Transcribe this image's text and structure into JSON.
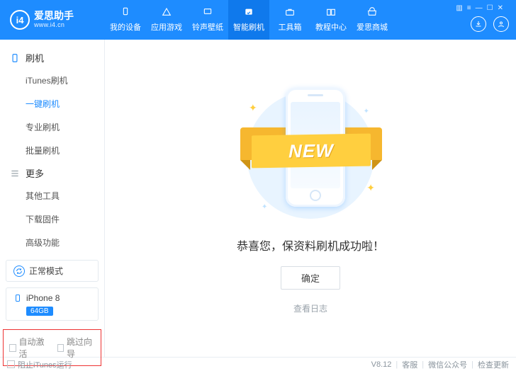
{
  "brand": {
    "name": "爱思助手",
    "url": "www.i4.cn",
    "mark": "i4"
  },
  "nav": {
    "items": [
      {
        "label": "我的设备"
      },
      {
        "label": "应用游戏"
      },
      {
        "label": "铃声壁纸"
      },
      {
        "label": "智能刷机"
      },
      {
        "label": "工具箱"
      },
      {
        "label": "教程中心"
      },
      {
        "label": "爱思商城"
      }
    ],
    "active": 3
  },
  "sidebar": {
    "group1": {
      "title": "刷机",
      "items": [
        "iTunes刷机",
        "一键刷机",
        "专业刷机",
        "批量刷机"
      ],
      "active": 1
    },
    "group2": {
      "title": "更多",
      "items": [
        "其他工具",
        "下载固件",
        "高级功能"
      ]
    }
  },
  "status": {
    "mode": "正常模式"
  },
  "device": {
    "name": "iPhone 8",
    "storage": "64GB"
  },
  "options": {
    "auto_activate": "自动激活",
    "skip_guide": "跳过向导"
  },
  "main": {
    "ribbon": "NEW",
    "message": "恭喜您，保资料刷机成功啦！",
    "ok": "确定",
    "view_log": "查看日志"
  },
  "footer": {
    "block_itunes": "阻止iTunes运行",
    "version": "V8.12",
    "support": "客服",
    "wechat": "微信公众号",
    "update": "检查更新"
  }
}
